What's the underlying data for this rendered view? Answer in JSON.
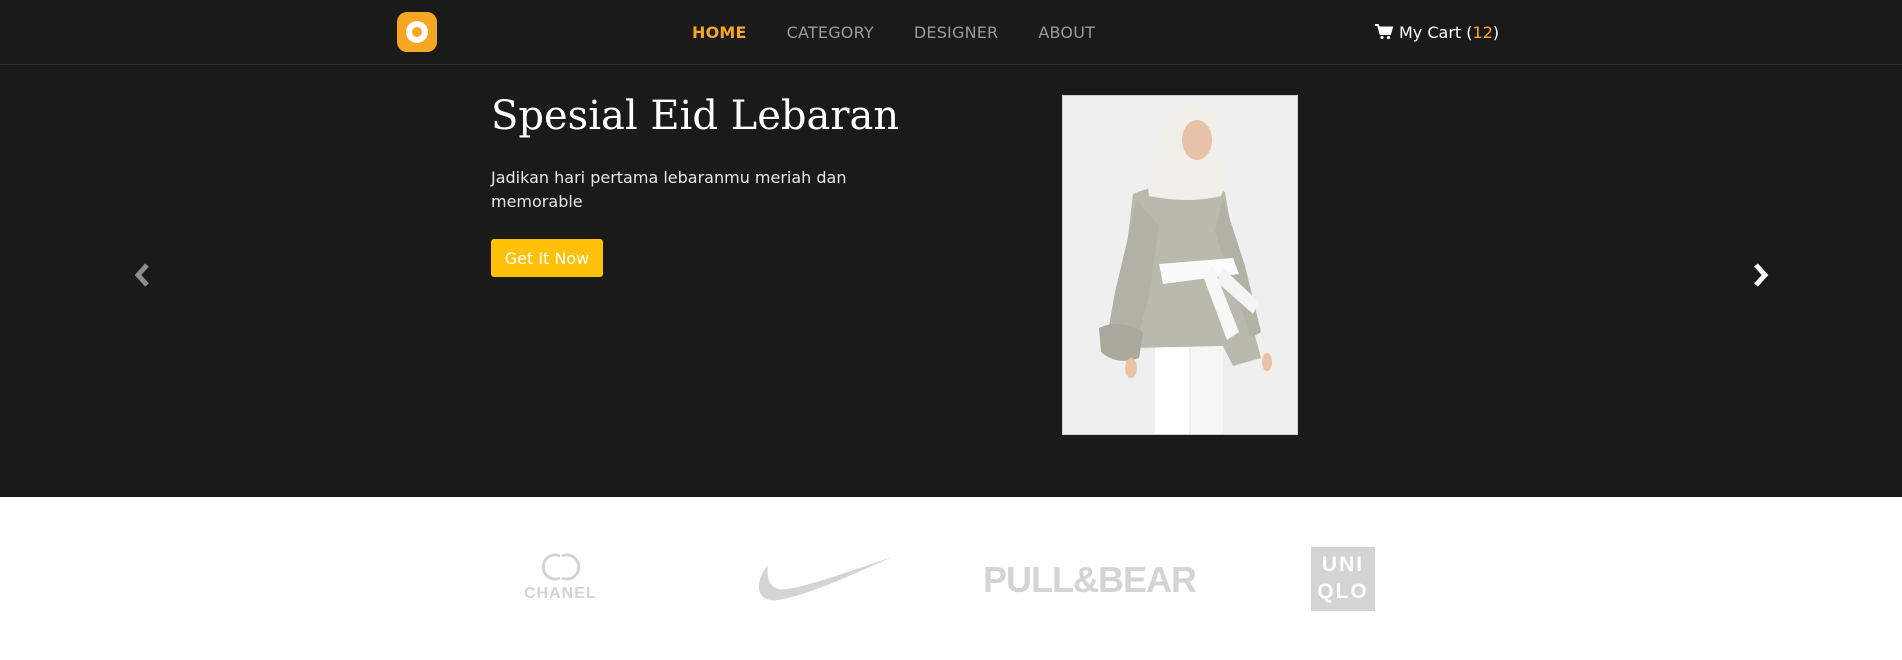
{
  "header": {
    "logo": "ring-logo-icon",
    "nav": [
      {
        "label": "HOME",
        "active": true
      },
      {
        "label": "CATEGORY",
        "active": false
      },
      {
        "label": "DESIGNER",
        "active": false
      },
      {
        "label": "ABOUT",
        "active": false
      }
    ],
    "cart": {
      "icon": "cart-icon",
      "label": "My Cart (",
      "count": "12",
      "close": ")"
    }
  },
  "hero": {
    "title": "Spesial Eid Lebaran",
    "subtitle": "Jadikan hari pertama lebaranmu meriah dan memorable",
    "cta_label": "Get It Now",
    "image": "hijab-fashion-model-photo"
  },
  "brands": [
    {
      "name": "CHANEL",
      "icon": "chanel-logo"
    },
    {
      "name": "Nike",
      "icon": "nike-swoosh-logo"
    },
    {
      "name": "PULL&BEAR",
      "icon": "pull-and-bear-logo"
    },
    {
      "name_lines": [
        "UNI",
        "QLO"
      ],
      "icon": "uniqlo-logo"
    }
  ],
  "colors": {
    "header_bg": "#1a1a1a",
    "accent": "#f5a623",
    "button": "#ffc107",
    "brand_logo": "#d4d4d4"
  }
}
